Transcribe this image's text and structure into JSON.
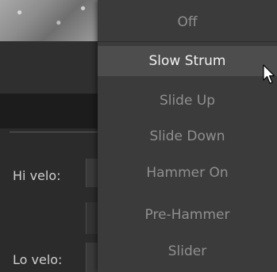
{
  "side_panel": {
    "hi_velo_label": "Hi velo:",
    "lo_velo_label": "Lo velo:"
  },
  "menu": {
    "items": [
      {
        "label": "Off",
        "highlighted": false
      },
      {
        "label": "Slow Strum",
        "highlighted": true
      },
      {
        "label": "Slide Up",
        "highlighted": false
      },
      {
        "label": "Slide Down",
        "highlighted": false
      },
      {
        "label": "Hammer On",
        "highlighted": false
      },
      {
        "label": "Pre-Hammer",
        "highlighted": false
      },
      {
        "label": "Slider",
        "highlighted": false
      }
    ]
  },
  "cursor_icon": "arrow-cursor-icon"
}
